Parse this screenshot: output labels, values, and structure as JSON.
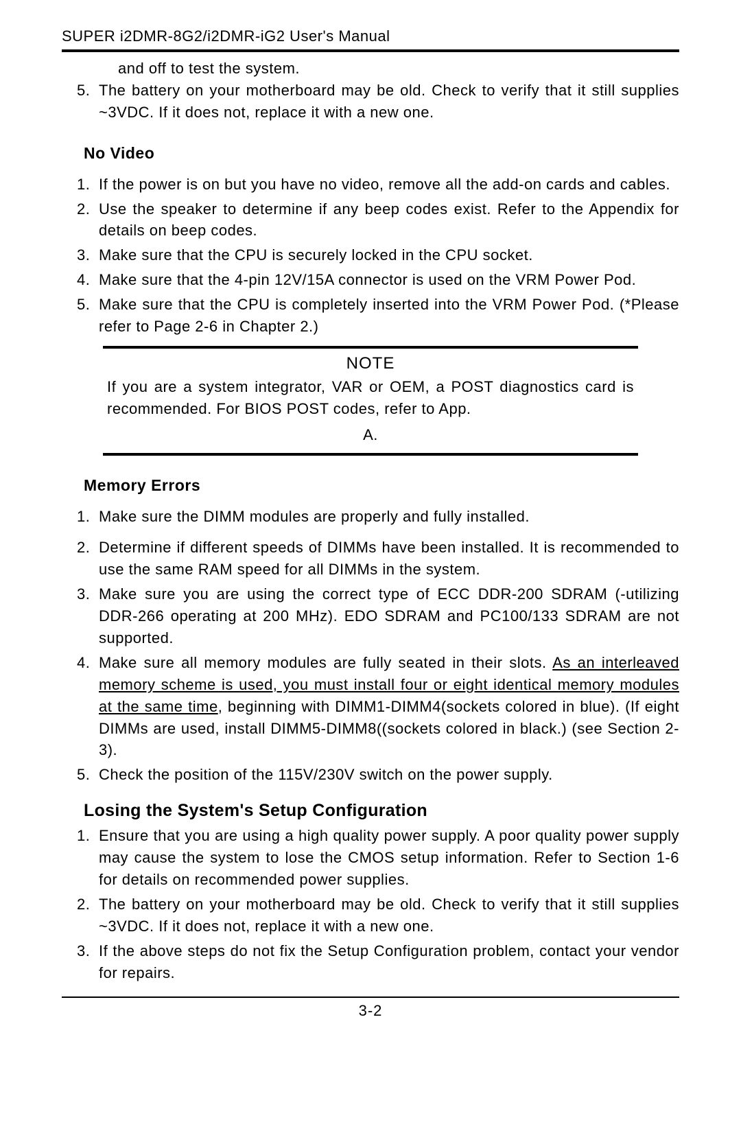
{
  "header": "SUPER i2DMR-8G2/i2DMR-iG2 User's Manual",
  "continuation_line": "and off to test the system.",
  "top_list_start": 5,
  "top_list": [
    "The battery on your motherboard may be old.  Check to verify that it still supplies ~3VDC.  If it does not, replace it with a new one."
  ],
  "no_video": {
    "heading": "No Video",
    "items": [
      "If the power is on but you have no video, remove all the add-on cards and cables.",
      "Use the speaker to determine if any beep codes exist.  Refer to the Appendix for details on beep codes.",
      "Make sure that the CPU is securely locked in the CPU socket.",
      "Make sure that the 4-pin 12V/15A connector is used on the VRM Power Pod.",
      "Make sure that the CPU is completely inserted into the VRM Power Pod. (*Please refer to  Page 2-6 in Chapter 2.)"
    ]
  },
  "note": {
    "title": "NOTE",
    "body_line1": "If you are a system integrator, VAR or OEM, a POST diagnostics card is recommended. For BIOS POST codes, refer to App.",
    "body_line2": "A."
  },
  "memory_errors": {
    "heading": "Memory Errors",
    "items_pre": [
      "Make sure the DIMM modules are properly and fully installed.",
      "Determine if different speeds of DIMMs have been installed.  It is recommended to use the same RAM speed for all DIMMs in the system.",
      "Make sure you are using the correct type of ECC DDR-200 SDRAM (-utilizing DDR-266 operating at 200 MHz).  EDO SDRAM and PC100/133 SDRAM are not supported."
    ],
    "item4_pre": "Make sure all memory modules are fully seated in their slots.  ",
    "item4_underline": "As an interleaved memory scheme is used, you must install four or eight identical memory modules at the same time",
    "item4_post": ", beginning with DIMM1-DIMM4(sockets colored in blue). (If eight DIMMs are used, install DIMM5-DIMM8((sockets colored in black.) (see Section 2-3).",
    "items_post": [
      "Check the position of the 115V/230V switch on the power supply."
    ]
  },
  "losing_setup": {
    "heading": "Losing the System's Setup Configuration",
    "items": [
      "Ensure that you are using a high quality power supply.  A poor quality power supply may cause the system to lose the CMOS setup information.  Refer to Section 1-6 for details on recommended power supplies.",
      "The battery on your motherboard may be old.  Check to verify that it still supplies ~3VDC.  If it does not, replace it with a new one.",
      "If the above steps do not fix the Setup Configuration problem, contact your vendor for repairs."
    ]
  },
  "page_number": "3-2"
}
